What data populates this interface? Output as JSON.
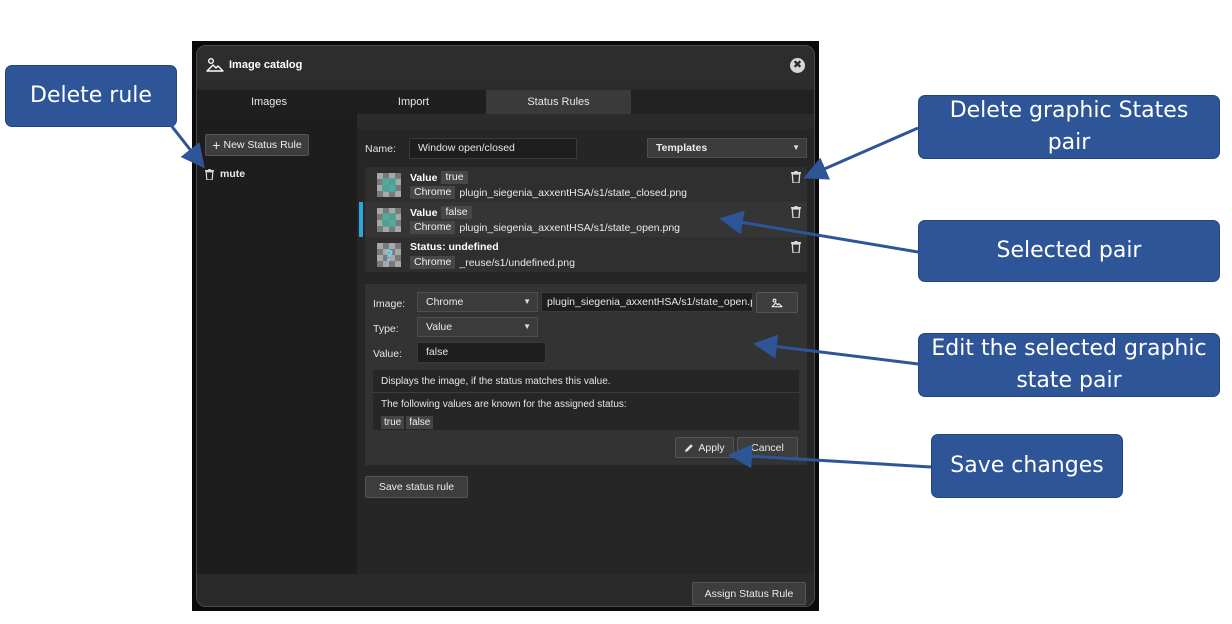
{
  "dialog": {
    "title": "Image catalog",
    "icons": {
      "title": "image-landscape-icon",
      "close": "close-icon"
    },
    "close_glyph": "✖",
    "tabs": [
      {
        "label": "Images"
      },
      {
        "label": "Import"
      },
      {
        "label": "Status Rules",
        "active": true
      }
    ],
    "left": {
      "new_rule_label": "New Status Rule",
      "new_rule_glyph": "+",
      "rules": [
        {
          "label": "mute"
        }
      ]
    },
    "main": {
      "name_label": "Name:",
      "name_value": "Window open/closed",
      "templates_label": "Templates",
      "pairs": [
        {
          "title": "Value",
          "value": "true",
          "source": "Chrome",
          "path": "plugin_siegenia_axxentHSA/s1/state_closed.png",
          "selected": false
        },
        {
          "title": "Value",
          "value": "false",
          "source": "Chrome",
          "path": "plugin_siegenia_axxentHSA/s1/state_open.png",
          "selected": true
        },
        {
          "title": "Status: undefined",
          "value": "",
          "source": "Chrome",
          "path": "_reuse/s1/undefined.png",
          "selected": false
        }
      ],
      "editor": {
        "image_label": "Image:",
        "image_source": "Chrome",
        "image_path": "plugin_siegenia_axxentHSA/s1/state_open.pr",
        "type_label": "Type:",
        "type_value": "Value",
        "value_label": "Value:",
        "value_value": "false",
        "info_line1": "Displays the image, if the status matches this value.",
        "info_line2": "The following values are known for the assigned status:",
        "known_values": [
          "true",
          "false"
        ],
        "apply_label": "Apply",
        "cancel_label": "Cancel"
      },
      "save_rule_label": "Save status rule"
    },
    "assign_label": "Assign Status Rule"
  },
  "callouts": {
    "delete_rule": "Delete rule",
    "delete_pair": "Delete graphic States pair",
    "selected_pair": "Selected pair",
    "edit_pair": "Edit the selected graphic state pair",
    "save_changes": "Save changes"
  },
  "colors": {
    "callout": "#2e5597",
    "selection_bar": "#29a8e0",
    "dialog_bg": "#2b2b2b"
  }
}
